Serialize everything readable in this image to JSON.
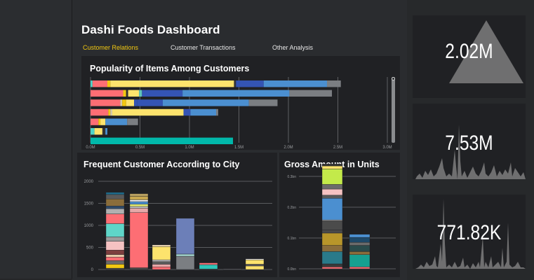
{
  "header": {
    "title": "Dashi Foods Dashboard"
  },
  "tabs": [
    {
      "label": "Customer Relations",
      "active": true
    },
    {
      "label": "Customer Transactions",
      "active": false
    },
    {
      "label": "Other Analysis",
      "active": false
    }
  ],
  "kpis": [
    {
      "value": "2.02M"
    },
    {
      "value": "7.53M"
    },
    {
      "value": "771.82K"
    }
  ],
  "colors": {
    "accent": "#f2c811",
    "background": "#252628",
    "panel": "#202124",
    "gridline": "#6e7073",
    "kpi_shape": "#6f6f70"
  },
  "chart_data": [
    {
      "type": "bar",
      "orientation": "horizontal",
      "stacked": true,
      "title": "Popularity of Items Among Customers",
      "x_ticks": [
        "0.0M",
        "0.5M",
        "1.0M",
        "1.5M",
        "2.0M",
        "2.5M",
        "3.0M"
      ],
      "xlim": [
        0,
        3.0
      ],
      "unit": "M",
      "rows": [
        {
          "segments": [
            {
              "v": 0.02,
              "c": "#4dd4c8"
            },
            {
              "v": 0.15,
              "c": "#fd6e74"
            },
            {
              "v": 0.03,
              "c": "#f2c811"
            },
            {
              "v": 1.25,
              "c": "#fde36d"
            },
            {
              "v": 0.02,
              "c": "#333333"
            },
            {
              "v": 0.28,
              "c": "#3454b4"
            },
            {
              "v": 0.64,
              "c": "#4b8fd0"
            },
            {
              "v": 0.14,
              "c": "#7b7e82"
            }
          ]
        },
        {
          "segments": [
            {
              "v": 0.33,
              "c": "#fd6e74"
            },
            {
              "v": 0.03,
              "c": "#f2c811"
            },
            {
              "v": 0.02,
              "c": "#333333"
            },
            {
              "v": 0.11,
              "c": "#fde36d"
            },
            {
              "v": 0.03,
              "c": "#5fc6b9"
            },
            {
              "v": 0.41,
              "c": "#3454b4"
            },
            {
              "v": 1.08,
              "c": "#4b8fd0"
            },
            {
              "v": 0.43,
              "c": "#7b7e82"
            }
          ]
        },
        {
          "segments": [
            {
              "v": 0.3,
              "c": "#fd6e74"
            },
            {
              "v": 0.02,
              "c": "#d6c8a8"
            },
            {
              "v": 0.04,
              "c": "#f2c811"
            },
            {
              "v": 0.08,
              "c": "#fde36d"
            },
            {
              "v": 0.03,
              "c": "#3454b4"
            },
            {
              "v": 0.26,
              "c": "#3454b4"
            },
            {
              "v": 0.87,
              "c": "#4b8fd0"
            },
            {
              "v": 0.29,
              "c": "#7b7e82"
            }
          ]
        },
        {
          "segments": [
            {
              "v": 0.18,
              "c": "#fd6e74"
            },
            {
              "v": 0.02,
              "c": "#f2c811"
            },
            {
              "v": 0.02,
              "c": "#d6c8a8"
            },
            {
              "v": 0.72,
              "c": "#fde36d"
            },
            {
              "v": 0.07,
              "c": "#3454b4"
            },
            {
              "v": 0.26,
              "c": "#4b8fd0"
            },
            {
              "v": 0.02,
              "c": "#7b7e82"
            }
          ]
        },
        {
          "segments": [
            {
              "v": 0.08,
              "c": "#fd6e74"
            },
            {
              "v": 0.02,
              "c": "#f2c811"
            },
            {
              "v": 0.05,
              "c": "#fde36d"
            },
            {
              "v": 0.22,
              "c": "#4b8fd0"
            },
            {
              "v": 0.11,
              "c": "#7b7e82"
            }
          ]
        },
        {
          "segments": [
            {
              "v": 0.04,
              "c": "#4dd4c8"
            },
            {
              "v": 0.08,
              "c": "#fde36d"
            },
            {
              "v": 0.03,
              "c": "#333333"
            },
            {
              "v": 0.02,
              "c": "#4b8fd0"
            }
          ]
        },
        {
          "segments": [
            {
              "v": 1.44,
              "c": "#01b8aa"
            }
          ]
        }
      ]
    },
    {
      "type": "bar",
      "stacked": true,
      "title": "Frequent Customer According to City",
      "y_ticks": [
        "2000",
        "1500",
        "1000",
        "500",
        "0"
      ],
      "ylim": [
        0,
        2000
      ],
      "columns": [
        {
          "segments": [
            {
              "v": 30,
              "c": "#4a4a4a"
            },
            {
              "v": 90,
              "c": "#f2c811"
            },
            {
              "v": 80,
              "c": "#6b6b6b"
            },
            {
              "v": 80,
              "c": "#fd6e74"
            },
            {
              "v": 60,
              "c": "#e6c9a8"
            },
            {
              "v": 100,
              "c": "#7d3f3f"
            },
            {
              "v": 200,
              "c": "#f5c2c2"
            },
            {
              "v": 100,
              "c": "#9b9b9b"
            },
            {
              "v": 300,
              "c": "#5fd5c8"
            },
            {
              "v": 220,
              "c": "#fd6e74"
            },
            {
              "v": 120,
              "c": "#b0b0b0"
            },
            {
              "v": 60,
              "c": "#2f4b6b"
            },
            {
              "v": 160,
              "c": "#8a6d3b"
            },
            {
              "v": 100,
              "c": "#5a5a5a"
            },
            {
              "v": 50,
              "c": "#1e6a8a"
            }
          ]
        },
        {
          "segments": [
            {
              "v": 40,
              "c": "#4a4a4a"
            },
            {
              "v": 1250,
              "c": "#fd6e74"
            },
            {
              "v": 100,
              "c": "#e6a8a8"
            },
            {
              "v": 40,
              "c": "#c0c0c0"
            },
            {
              "v": 50,
              "c": "#e3ea6f"
            },
            {
              "v": 60,
              "c": "#4b8fd0"
            },
            {
              "v": 40,
              "c": "#f4f4f4"
            },
            {
              "v": 80,
              "c": "#c8a850"
            },
            {
              "v": 60,
              "c": "#b8a060"
            }
          ]
        },
        {
          "segments": [
            {
              "v": 60,
              "c": "#fd6e74"
            },
            {
              "v": 60,
              "c": "#e6a8a8"
            },
            {
              "v": 60,
              "c": "#5a5a5a"
            },
            {
              "v": 40,
              "c": "#c0c0c0"
            },
            {
              "v": 300,
              "c": "#fde36d"
            },
            {
              "v": 40,
              "c": "#e6d0b0"
            }
          ]
        },
        {
          "segments": [
            {
              "v": 300,
              "c": "#7b7e82"
            },
            {
              "v": 50,
              "c": "#9fd0c8"
            },
            {
              "v": 810,
              "c": "#6c7fb8"
            }
          ]
        },
        {
          "segments": [
            {
              "v": 10,
              "c": "#4a4a4a"
            },
            {
              "v": 100,
              "c": "#2fc4b8"
            },
            {
              "v": 40,
              "c": "#fd6e74"
            }
          ]
        },
        {
          "segments": [
            {
              "v": 15,
              "c": "#7b7e82"
            }
          ]
        },
        {
          "segments": [
            {
              "v": 80,
              "c": "#fde36d"
            },
            {
              "v": 40,
              "c": "#5a5a5a"
            },
            {
              "v": 100,
              "c": "#fde36d"
            },
            {
              "v": 20,
              "c": "#ffffff"
            }
          ]
        }
      ]
    },
    {
      "type": "bar",
      "stacked": true,
      "title": "Gross Amount in Units",
      "y_ticks": [
        "0.3bn",
        "0.2bn",
        "0.1bn",
        "0.0bn"
      ],
      "ylim": [
        0,
        0.3
      ],
      "columns": [
        {
          "segments": [
            {
              "v": 0.006,
              "c": "#fd6e74"
            },
            {
              "v": 0.01,
              "c": "#3a3a3a"
            },
            {
              "v": 0.04,
              "c": "#2a7a8a"
            },
            {
              "v": 0.02,
              "c": "#8a6d3b"
            },
            {
              "v": 0.04,
              "c": "#b8962a"
            },
            {
              "v": 0.01,
              "c": "#4a4a4a"
            },
            {
              "v": 0.03,
              "c": "#4b4b4b"
            },
            {
              "v": 0.003,
              "c": "#d8d8d8"
            },
            {
              "v": 0.07,
              "c": "#4b8fd0"
            },
            {
              "v": 0.01,
              "c": "#5a5a5a"
            },
            {
              "v": 0.02,
              "c": "#f5c2c2"
            },
            {
              "v": 0.015,
              "c": "#6b6b6b"
            },
            {
              "v": 0.05,
              "c": "#c3ea4a"
            },
            {
              "v": 0.01,
              "c": "#fde36d"
            },
            {
              "v": 0.006,
              "c": "#333333"
            }
          ]
        },
        {
          "segments": [
            {
              "v": 0.006,
              "c": "#fd6e74"
            },
            {
              "v": 0.04,
              "c": "#16a090"
            },
            {
              "v": 0.01,
              "c": "#8a6d3b"
            },
            {
              "v": 0.02,
              "c": "#2a4b4b"
            },
            {
              "v": 0.01,
              "c": "#6b6b6b"
            },
            {
              "v": 0.016,
              "c": "#1e4a6a"
            },
            {
              "v": 0.01,
              "c": "#4b8fd0"
            }
          ]
        }
      ]
    }
  ]
}
